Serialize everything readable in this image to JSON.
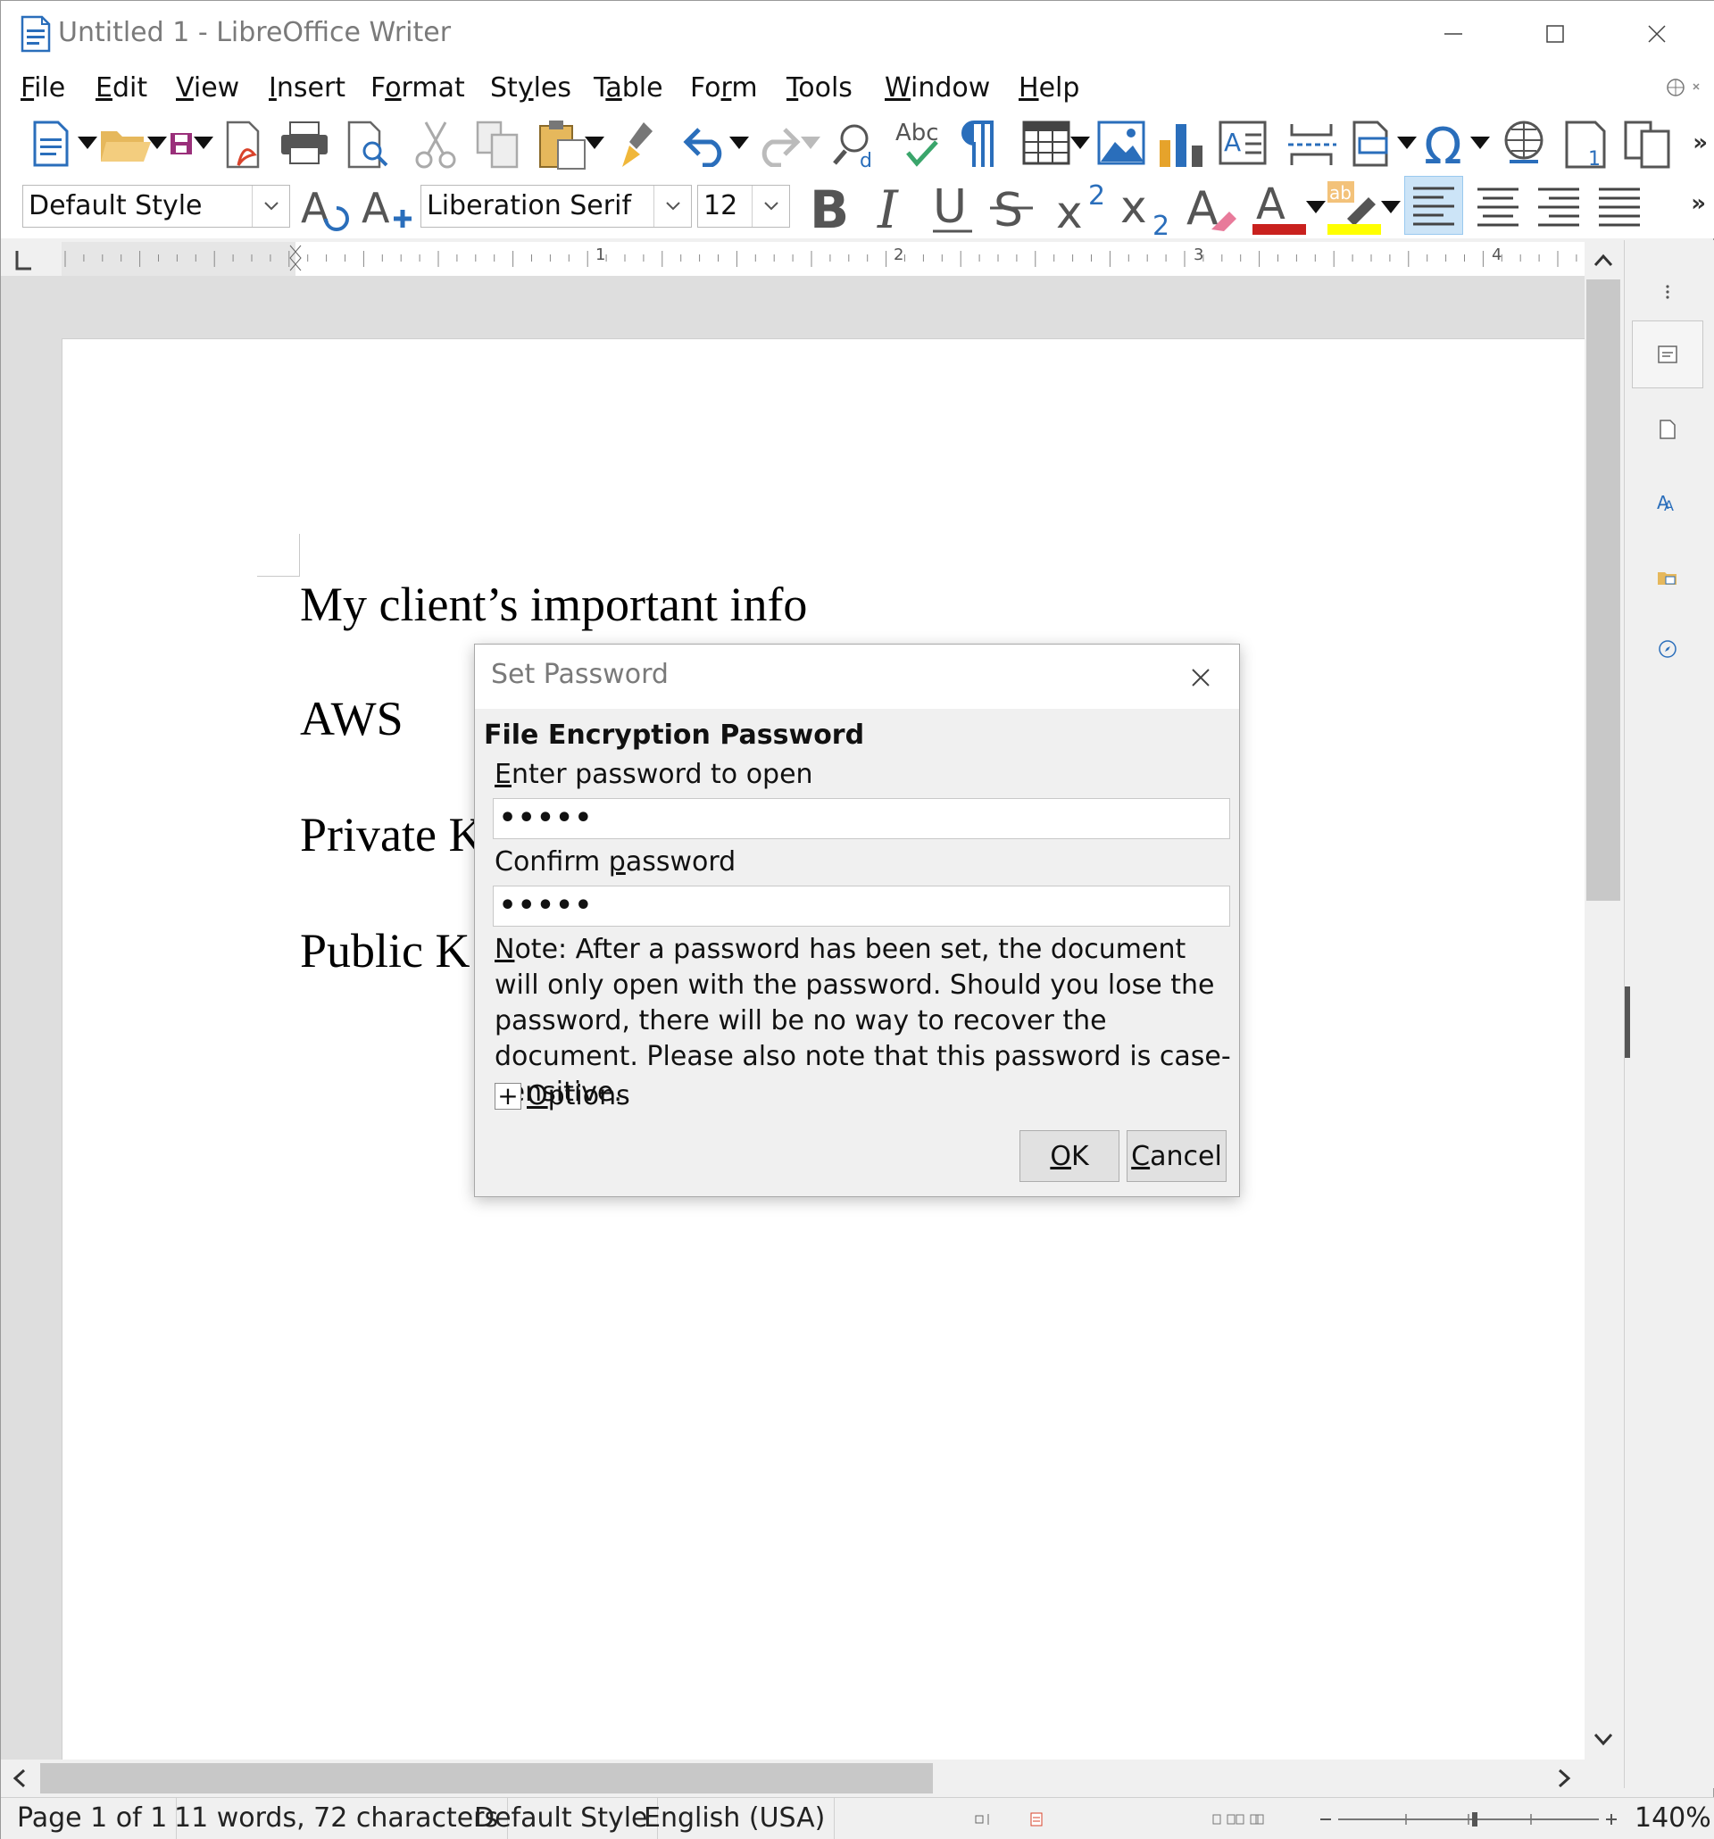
{
  "window": {
    "title": "Untitled 1 - LibreOffice Writer"
  },
  "menu": {
    "items": [
      {
        "pre": "",
        "acc": "F",
        "post": "ile"
      },
      {
        "pre": "",
        "acc": "E",
        "post": "dit"
      },
      {
        "pre": "",
        "acc": "V",
        "post": "iew"
      },
      {
        "pre": "",
        "acc": "I",
        "post": "nsert"
      },
      {
        "pre": "F",
        "acc": "o",
        "post": "rmat"
      },
      {
        "pre": "St",
        "acc": "y",
        "post": "les"
      },
      {
        "pre": "T",
        "acc": "a",
        "post": "ble"
      },
      {
        "pre": "Fo",
        "acc": "r",
        "post": "m"
      },
      {
        "pre": "",
        "acc": "T",
        "post": "ools"
      },
      {
        "pre": "",
        "acc": "W",
        "post": "indow"
      },
      {
        "pre": "",
        "acc": "H",
        "post": "elp"
      }
    ]
  },
  "toolbar": {
    "paragraph_style": "Default Style",
    "font_name": "Liberation Serif",
    "font_size": "12",
    "more": "»"
  },
  "ruler": {
    "marks": [
      "1",
      "2",
      "3",
      "4"
    ]
  },
  "document": {
    "lines": [
      "My client’s important info",
      "AWS",
      "Private K",
      "Public K"
    ]
  },
  "dialog": {
    "title": "Set Password",
    "section": "File Encryption Password",
    "enter_label_acc": "E",
    "enter_label_rest": "nter password to open",
    "enter_value": "•••••",
    "confirm_label_pre": "Confirm ",
    "confirm_label_acc": "p",
    "confirm_label_rest": "assword",
    "confirm_value": "•••••",
    "note_acc": "N",
    "note_rest": "ote: After a password has been set, the document will only open with the password. Should you lose the password, there will be no way to recover the document. Please also note that this password is case-sensitive.",
    "options_acc": "O",
    "options_rest": "ptions",
    "ok_acc": "O",
    "ok_rest": "K",
    "cancel_acc": "C",
    "cancel_rest": "ancel"
  },
  "statusbar": {
    "page": "Page 1 of 1",
    "words": "11 words, 72 characters",
    "style": "Default Style",
    "language": "English (USA)",
    "zoom": "140%"
  },
  "colors": {
    "accent": "#2a6ebb",
    "font_color": "#c9211e",
    "highlight": "#ffff00",
    "selected_button": "#cce4f7"
  }
}
